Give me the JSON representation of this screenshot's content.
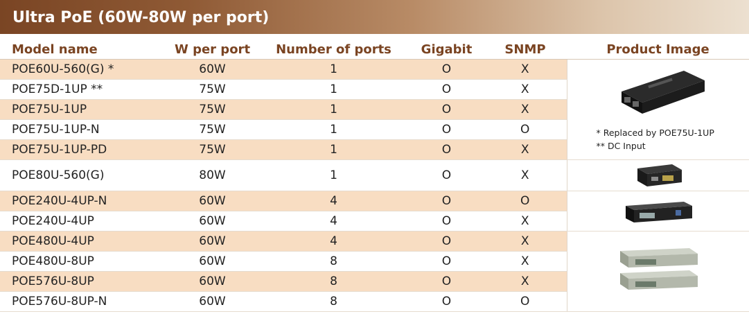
{
  "title": "Ultra PoE (60W-80W per port)",
  "headers": [
    "Model name",
    "W per port",
    "Number of ports",
    "Gigabit",
    "SNMP",
    "Product Image"
  ],
  "rows": [
    {
      "model": "POE60U-560(G) *",
      "w": "60W",
      "ports": "1",
      "gigabit": "O",
      "snmp": "X",
      "shade": true
    },
    {
      "model": "POE75D-1UP **",
      "w": "75W",
      "ports": "1",
      "gigabit": "O",
      "snmp": "X",
      "shade": false
    },
    {
      "model": "POE75U-1UP",
      "w": "75W",
      "ports": "1",
      "gigabit": "O",
      "snmp": "X",
      "shade": true
    },
    {
      "model": "POE75U-1UP-N",
      "w": "75W",
      "ports": "1",
      "gigabit": "O",
      "snmp": "O",
      "shade": false
    },
    {
      "model": "POE75U-1UP-PD",
      "w": "75W",
      "ports": "1",
      "gigabit": "O",
      "snmp": "X",
      "shade": true
    },
    {
      "model": "POE80U-560(G)",
      "w": "80W",
      "ports": "1",
      "gigabit": "O",
      "snmp": "X",
      "shade": false
    },
    {
      "model": "POE240U-4UP-N",
      "w": "60W",
      "ports": "4",
      "gigabit": "O",
      "snmp": "O",
      "shade": true
    },
    {
      "model": "POE240U-4UP",
      "w": "60W",
      "ports": "4",
      "gigabit": "O",
      "snmp": "X",
      "shade": false
    },
    {
      "model": "POE480U-4UP",
      "w": "60W",
      "ports": "4",
      "gigabit": "O",
      "snmp": "X",
      "shade": true
    },
    {
      "model": "POE480U-8UP",
      "w": "60W",
      "ports": "8",
      "gigabit": "O",
      "snmp": "X",
      "shade": false
    },
    {
      "model": "POE576U-8UP",
      "w": "60W",
      "ports": "8",
      "gigabit": "O",
      "snmp": "X",
      "shade": true
    },
    {
      "model": "POE576U-8UP-N",
      "w": "60W",
      "ports": "8",
      "gigabit": "O",
      "snmp": "O",
      "shade": false
    }
  ],
  "notes": [
    "* Replaced by POE75U-1UP",
    "** DC Input"
  ],
  "colors": {
    "header_text": "#7a4422",
    "shade": "#f8ddc2",
    "title_bar": "#7a4524"
  }
}
